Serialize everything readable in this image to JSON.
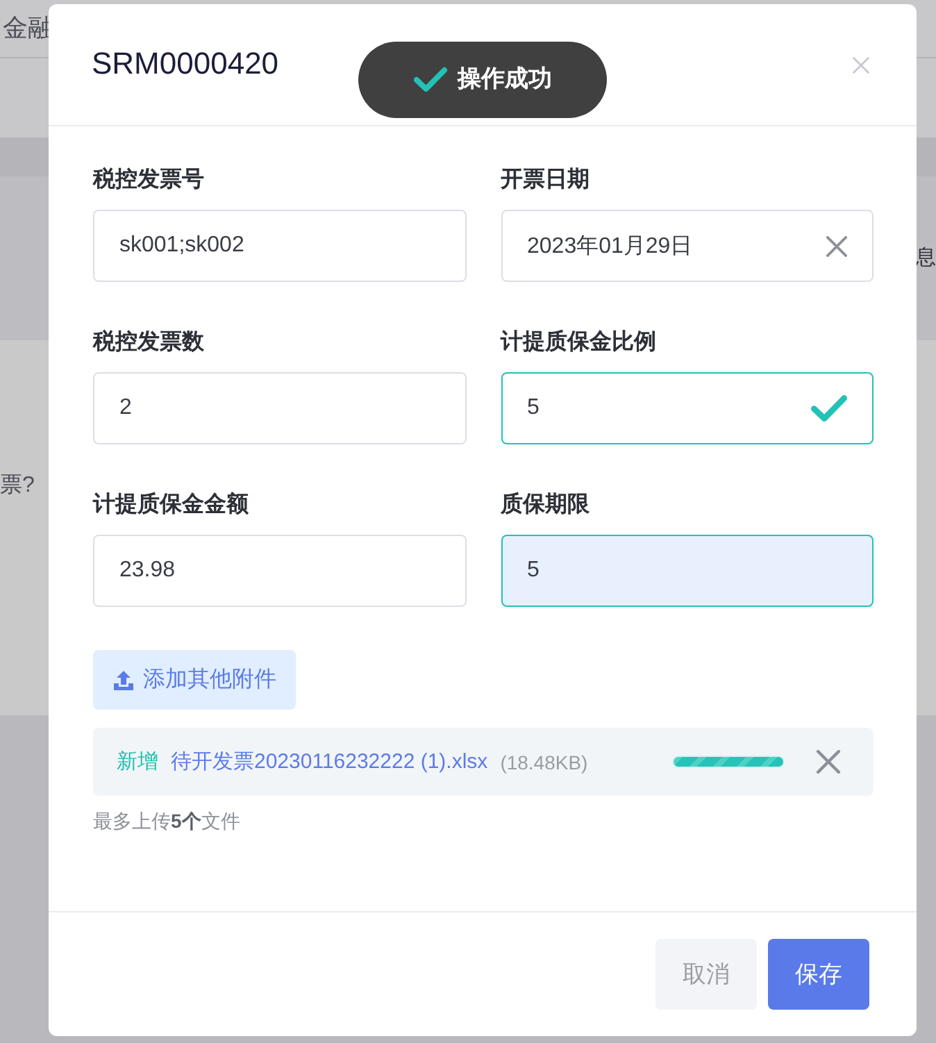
{
  "background": {
    "tab_fragment": "金融",
    "row_fragment_right": "息",
    "row_fragment_left": "票?"
  },
  "dialog": {
    "title": "SRM0000420"
  },
  "toast": {
    "message": "操作成功"
  },
  "form": {
    "fields": [
      {
        "label": "税控发票号",
        "value": "sk001;sk002",
        "clearable": false,
        "valid": false,
        "focused": false
      },
      {
        "label": "开票日期",
        "value": "2023年01月29日",
        "clearable": true,
        "valid": false,
        "focused": false
      },
      {
        "label": "税控发票数",
        "value": "2",
        "clearable": false,
        "valid": false,
        "focused": false
      },
      {
        "label": "计提质保金比例",
        "value": "5",
        "clearable": false,
        "valid": true,
        "focused": false
      },
      {
        "label": "计提质保金金额",
        "value": "23.98",
        "clearable": false,
        "valid": false,
        "focused": false
      },
      {
        "label": "质保期限",
        "value": "5",
        "clearable": false,
        "valid": false,
        "focused": true
      }
    ]
  },
  "upload": {
    "button": "添加其他附件",
    "files": [
      {
        "status": "新增",
        "name": "待开发票20230116232222 (1).xlsx",
        "size": "(18.48KB)",
        "level": 1
      }
    ],
    "hint": "最多上传**5个**文件"
  },
  "footer": {
    "buttons": [
      {
        "label": "取消",
        "kind": "secondary"
      },
      {
        "label": "保存",
        "kind": "primary"
      }
    ]
  }
}
